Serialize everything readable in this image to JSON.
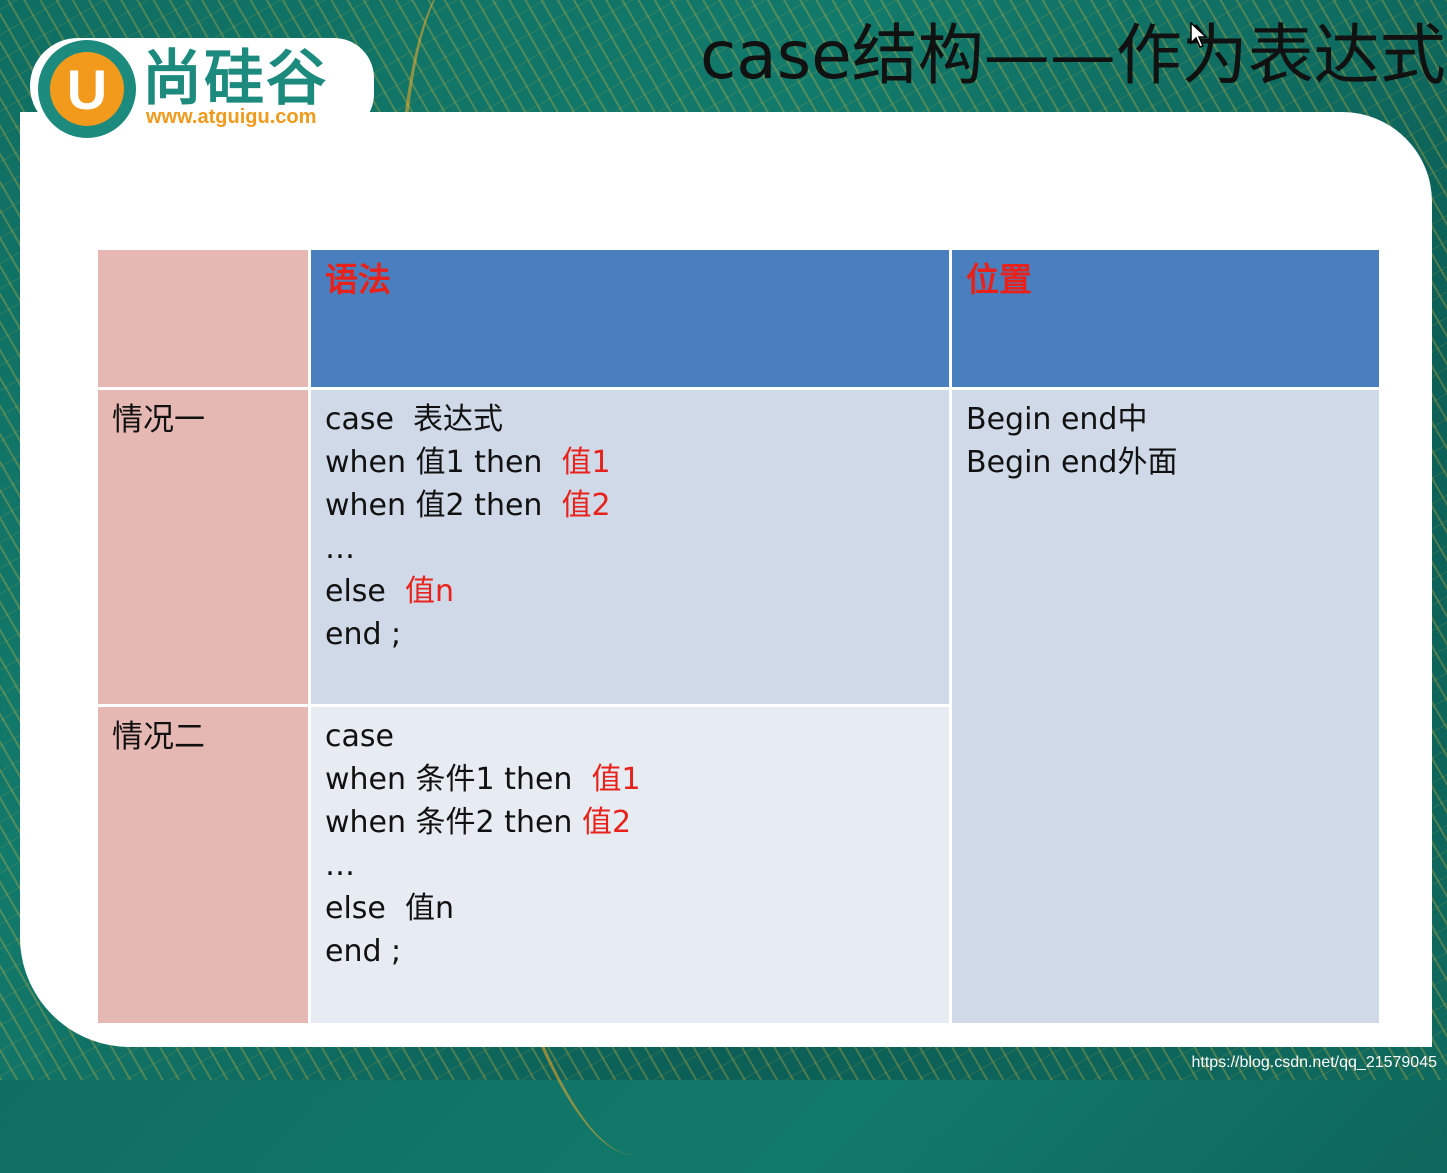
{
  "slide": {
    "title": "case结构——作为表达式"
  },
  "logo": {
    "letter": "U",
    "name": "尚硅谷",
    "url": "www.atguigu.com",
    "icon": "logo-icon"
  },
  "table": {
    "headers": {
      "syntax": "语法",
      "position": "位置"
    },
    "case1": {
      "label": "情况一",
      "lines": [
        [
          {
            "text": "case  表达式"
          }
        ],
        [
          {
            "text": "when 值1 then  "
          },
          {
            "text": "值1",
            "red": true
          }
        ],
        [
          {
            "text": "when 值2 then  "
          },
          {
            "text": "值2",
            "red": true
          }
        ],
        [
          {
            "text": "…"
          }
        ],
        [
          {
            "text": "else  "
          },
          {
            "text": "值n",
            "red": true
          }
        ],
        [
          {
            "text": "end ;"
          }
        ]
      ]
    },
    "case2": {
      "label": "情况二",
      "lines": [
        [
          {
            "text": "case"
          }
        ],
        [
          {
            "text": "when 条件1 then  "
          },
          {
            "text": "值1",
            "red": true
          }
        ],
        [
          {
            "text": "when 条件2 then "
          },
          {
            "text": "值2",
            "red": true
          }
        ],
        [
          {
            "text": "…"
          }
        ],
        [
          {
            "text": "else  值n"
          }
        ],
        [
          {
            "text": "end ;"
          }
        ]
      ]
    },
    "position_lines": [
      "Begin end中",
      "Begin end外面"
    ]
  },
  "watermark": "https://blog.csdn.net/qq_21579045",
  "colors": {
    "header_blue": "#4a7fbf",
    "label_pink": "#e6b8b3",
    "row1_blue": "#cfd9e8",
    "row2_blue": "#e7ecf3",
    "accent_red": "#e8221b",
    "brand_teal": "#1d8a7e",
    "brand_orange": "#f19a1c"
  }
}
